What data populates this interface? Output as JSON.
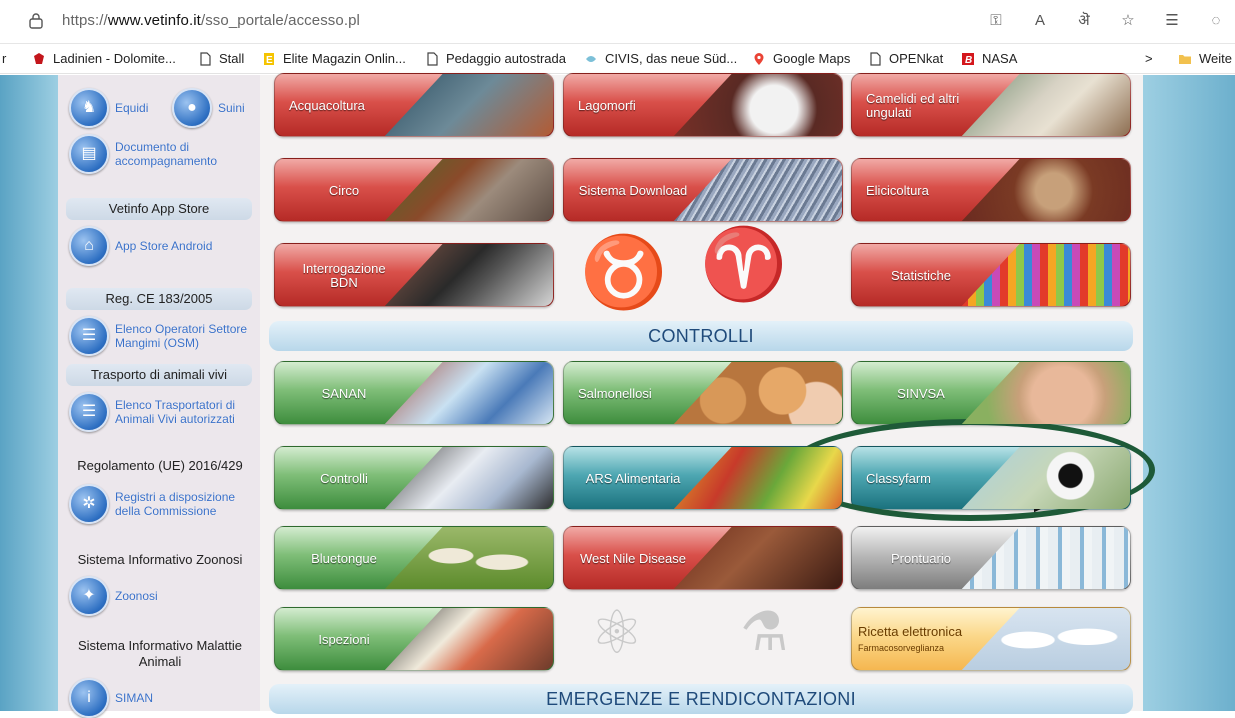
{
  "browser": {
    "url_prefix": "https://",
    "url_domain": "www.vetinfo.it",
    "url_path": "/sso_portale/accesso.pl",
    "bookmarks": [
      {
        "label": "Ladinien - Dolomite...",
        "icon": "emblem-icon"
      },
      {
        "label": "Stall",
        "icon": "page-icon"
      },
      {
        "label": "Elite Magazin Onlin...",
        "icon": "e-icon"
      },
      {
        "label": "Pedaggio autostrada",
        "icon": "page-icon"
      },
      {
        "label": "CIVIS, das neue Süd...",
        "icon": "civis-icon"
      },
      {
        "label": "Google Maps",
        "icon": "maps-pin-icon"
      },
      {
        "label": "OPENkat",
        "icon": "page-icon"
      },
      {
        "label": "NASA",
        "icon": "b-icon"
      },
      {
        "label": "Weite",
        "icon": "folder-icon"
      }
    ],
    "left_fragment": "r"
  },
  "sidebar": {
    "equidi": "Equidi",
    "suini": "Suini",
    "documento": "Documento di accompagnamento",
    "app_store_head": "Vetinfo App Store",
    "app_store_android": "App Store Android",
    "reg_ce_head": "Reg. CE 183/2005",
    "elenco_operatori": "Elenco Operatori Settore Mangimi (OSM)",
    "trasporto_head": "Trasporto di animali vivi",
    "elenco_trasportatori": "Elenco Trasportatori di Animali Vivi autorizzati",
    "regolamento_head": "Regolamento (UE) 2016/429",
    "registri": "Registri a disposizione della Commissione",
    "zoonosi_head": "Sistema Informativo Zoonosi",
    "zoonosi": "Zoonosi",
    "malattie_head": "Sistema Informativo Malattie Animali",
    "siman": "SIMAN"
  },
  "tiles": {
    "acquacoltura": "Acquacoltura",
    "lagomorfi": "Lagomorfi",
    "camelidi": "Camelidi ed altri ungulati",
    "circo": "Circo",
    "sistema_download": "Sistema Download",
    "elicicoltura": "Elicicoltura",
    "interrogazione": "Interrogazione BDN",
    "statistiche": "Statistiche",
    "sanan": "SANAN",
    "salmonellosi": "Salmonellosi",
    "sinvsa": "SINVSA",
    "controlli": "Controlli",
    "ars": "ARS Alimentaria",
    "classyfarm": "Classyfarm",
    "bluetongue": "Bluetongue",
    "west_nile": "West Nile Disease",
    "prontuario": "Prontuario",
    "ispezioni": "Ispezioni",
    "ricetta": "Ricetta elettronica",
    "ricetta_sub": "Farmacosorveglianza"
  },
  "sections": {
    "controlli": "CONTROLLI",
    "emergenze": "EMERGENZE E RENDICONTAZIONI"
  },
  "colors": {
    "highlight_oval": "#1e5a38",
    "red_tile": "#d9504a",
    "green_tile": "#7fbe78",
    "teal_tile": "#4ea7b2"
  }
}
